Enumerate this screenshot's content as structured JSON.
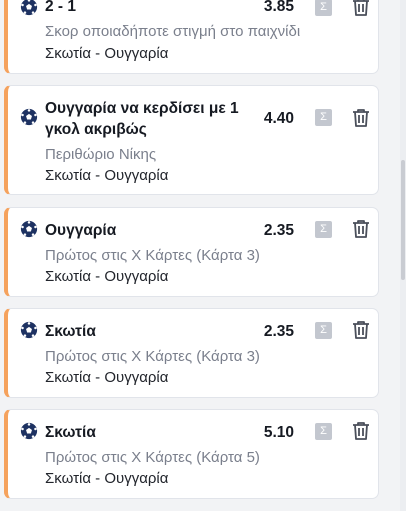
{
  "bets": [
    {
      "selection": "2 - 1",
      "odds": "3.85",
      "market": "Σκορ οποιαδήποτε στιγμή στο παιχνίδι",
      "event": "Σκωτία - Ουγγαρία",
      "sigma": "Σ",
      "icons": [
        "football-icon",
        "sigma-icon",
        "trash-icon"
      ]
    },
    {
      "selection": "Ουγγαρία να κερδίσει με 1 γκολ ακριβώς",
      "odds": "4.40",
      "market": "Περιθώριο Νίκης",
      "event": "Σκωτία - Ουγγαρία",
      "sigma": "Σ"
    },
    {
      "selection": "Ουγγαρία",
      "odds": "2.35",
      "market": "Πρώτος στις Χ Κάρτες (Κάρτα 3)",
      "event": "Σκωτία - Ουγγαρία",
      "sigma": "Σ"
    },
    {
      "selection": "Σκωτία",
      "odds": "2.35",
      "market": "Πρώτος στις Χ Κάρτες (Κάρτα 3)",
      "event": "Σκωτία - Ουγγαρία",
      "sigma": "Σ"
    },
    {
      "selection": "Σκωτία",
      "odds": "5.10",
      "market": "Πρώτος στις Χ Κάρτες (Κάρτα 5)",
      "event": "Σκωτία - Ουγγαρία",
      "sigma": "Σ"
    }
  ],
  "colors": {
    "accent": "#f5a25d",
    "ball": "#1e3262",
    "sigma_bg": "#c3c7cf",
    "trash": "#4a4f5a"
  }
}
